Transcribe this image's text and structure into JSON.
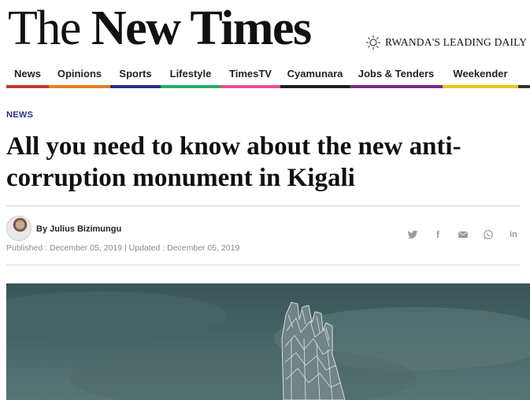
{
  "masthead": {
    "logo_word1": "The",
    "logo_word2": "New Times",
    "tagline": "RWANDA'S LEADING DAILY",
    "logo_mark": "sun-icon"
  },
  "nav": {
    "items": [
      {
        "label": "News",
        "color": "#c0392b"
      },
      {
        "label": "Opinions",
        "color": "#e67e22"
      },
      {
        "label": "Sports",
        "color": "#2b2f8a"
      },
      {
        "label": "Lifestyle",
        "color": "#27ae60"
      },
      {
        "label": "TimesTV",
        "color": "#e94e9a"
      },
      {
        "label": "Cyamunara",
        "color": "#1f1f1f"
      },
      {
        "label": "Jobs & Tenders",
        "color": "#7b2a8c"
      },
      {
        "label": "Weekender",
        "color": "#f1c40f"
      }
    ]
  },
  "article": {
    "section": "NEWS",
    "headline": "All you need to know about the new anti-corruption monument in Kigali",
    "byline": "By Julius Bizimungu",
    "dates": "Published : December 05, 2019 | Updated : December 05, 2019"
  },
  "share": {
    "icons": [
      "twitter-icon",
      "facebook-icon",
      "email-icon",
      "whatsapp-icon",
      "linkedin-icon"
    ],
    "facebook_glyph": "f",
    "linkedin_glyph": "in"
  },
  "hero": {
    "description_icon": "monument-photo"
  }
}
